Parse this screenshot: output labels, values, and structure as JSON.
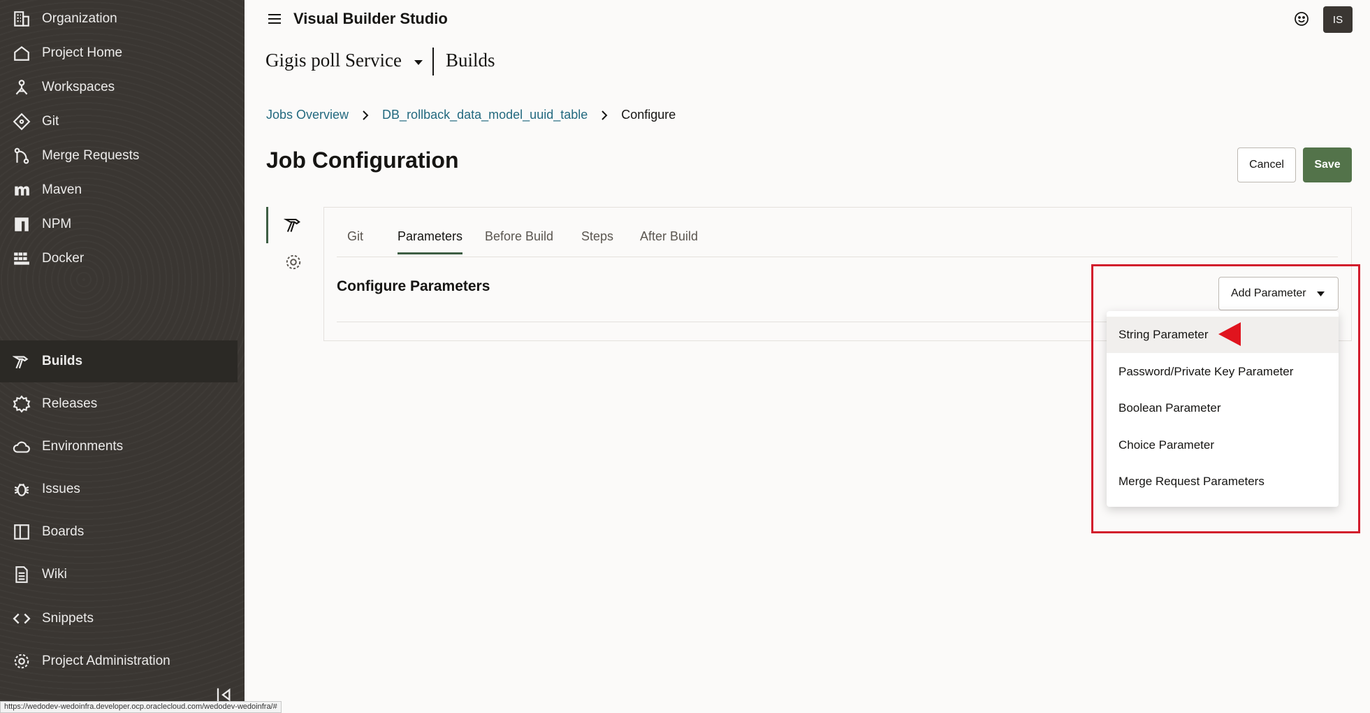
{
  "sidebar": {
    "items": [
      {
        "label": "Organization",
        "icon": "building-icon"
      },
      {
        "label": "Project Home",
        "icon": "home-icon"
      },
      {
        "label": "Workspaces",
        "icon": "workspace-icon"
      },
      {
        "label": "Git",
        "icon": "git-icon"
      },
      {
        "label": "Merge Requests",
        "icon": "merge-icon"
      },
      {
        "label": "Maven",
        "icon": "maven-icon"
      },
      {
        "label": "NPM",
        "icon": "npm-icon"
      },
      {
        "label": "Docker",
        "icon": "docker-icon"
      },
      {
        "label": "Builds",
        "icon": "hammer-icon",
        "active": true
      },
      {
        "label": "Releases",
        "icon": "releases-icon"
      },
      {
        "label": "Environments",
        "icon": "cloud-icon"
      },
      {
        "label": "Issues",
        "icon": "bug-icon"
      },
      {
        "label": "Boards",
        "icon": "board-icon"
      },
      {
        "label": "Wiki",
        "icon": "wiki-icon"
      },
      {
        "label": "Snippets",
        "icon": "code-icon"
      },
      {
        "label": "Project Administration",
        "icon": "gear-icon"
      }
    ],
    "status_url": "https://wedodev-wedoinfra.developer.ocp.oraclecloud.com/wedodev-wedoinfra/#"
  },
  "header": {
    "app_title": "Visual Builder Studio",
    "avatar_initials": "IS",
    "project_name": "Gigis poll Service",
    "section_name": "Builds"
  },
  "breadcrumb": {
    "items": [
      "Jobs Overview",
      "DB_rollback_data_model_uuid_table"
    ],
    "current": "Configure"
  },
  "page": {
    "title": "Job Configuration",
    "cancel_label": "Cancel",
    "save_label": "Save"
  },
  "tabs": [
    {
      "label": "Git"
    },
    {
      "label": "Parameters",
      "active": true
    },
    {
      "label": "Before Build"
    },
    {
      "label": "Steps"
    },
    {
      "label": "After Build"
    }
  ],
  "parameters": {
    "heading": "Configure Parameters",
    "add_button_label": "Add Parameter",
    "menu_items": [
      "String Parameter",
      "Password/Private Key Parameter",
      "Boolean Parameter",
      "Choice Parameter",
      "Merge Request Parameters"
    ],
    "highlighted_item": "String Parameter"
  },
  "colors": {
    "sidebar_bg": "#3a3632",
    "accent_green": "#53734a",
    "link": "#22697f",
    "annotation_red": "#d21c2c"
  }
}
